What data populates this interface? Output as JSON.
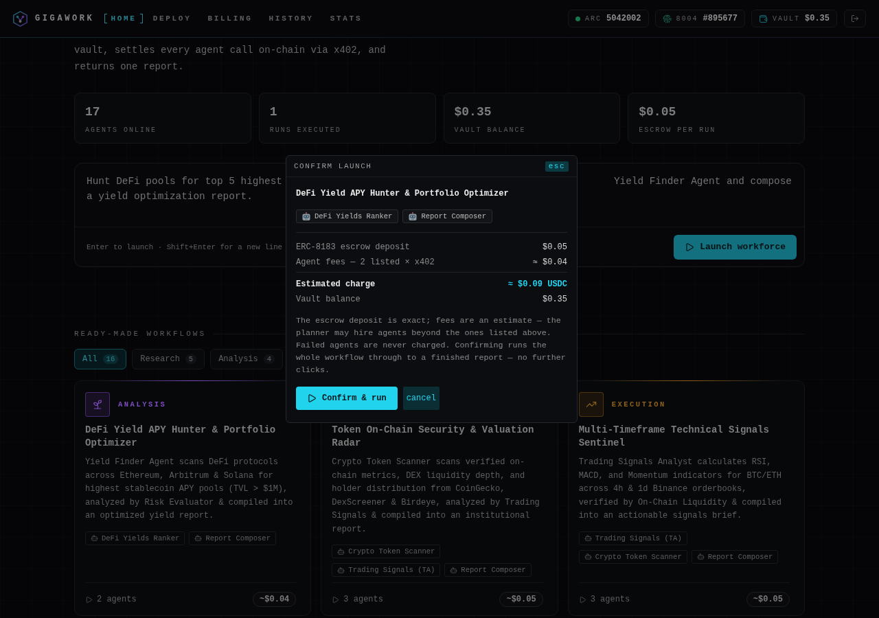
{
  "nav": {
    "brand": "GIGAWORK",
    "links": [
      {
        "label": "HOME",
        "selected": true
      },
      {
        "label": "DEPLOY",
        "selected": false
      },
      {
        "label": "BILLING",
        "selected": false
      },
      {
        "label": "HISTORY",
        "selected": false
      },
      {
        "label": "STATS",
        "selected": false
      }
    ],
    "pills": [
      {
        "kind": "status",
        "label": "ARC",
        "value": "5042002"
      },
      {
        "kind": "identity",
        "label": "8004",
        "value": "#895677"
      },
      {
        "kind": "vault",
        "label": "VAULT",
        "value": "$0.35"
      }
    ]
  },
  "hero": {
    "text": "vault, settles every agent call on-chain via x402, and returns one report."
  },
  "stats": [
    {
      "value": "17",
      "label": "AGENTS ONLINE"
    },
    {
      "value": "1",
      "label": "RUNS EXECUTED"
    },
    {
      "value": "$0.35",
      "label": "VAULT BALANCE"
    },
    {
      "value": "$0.05",
      "label": "ESCROW PER RUN"
    }
  ],
  "prompt": {
    "value_parts": [
      "Hunt DeFi pools for top 5 highest",
      "Yield Finder Agent and compose",
      "a yield optimization report."
    ],
    "hint": "Enter to launch · Shift+Enter for a new line",
    "button": "Launch workforce"
  },
  "workflows": {
    "title": "READY-MADE WORKFLOWS",
    "filters": [
      {
        "label": "All",
        "count": "16",
        "selected": true
      },
      {
        "label": "Research",
        "count": "5",
        "selected": false
      },
      {
        "label": "Analysis",
        "count": "4",
        "selected": false
      }
    ],
    "cards": [
      {
        "kind": "analysis",
        "category": "ANALYSIS",
        "color": "#7b4cc0",
        "title": "DeFi Yield APY Hunter & Portfolio Optimizer",
        "description": "Yield Finder Agent scans DeFi protocols across Ethereum, Arbitrum & Solana for highest stablecoin APY pools (TVL > $1M), analyzed by Risk Evaluator & compiled into an optimized yield report.",
        "agents": [
          "DeFi Yields Ranker",
          "Report Composer"
        ],
        "agent_count": "2 agents",
        "price": "~$0.04"
      },
      {
        "title": "Token On-Chain Security & Valuation Radar",
        "description": "Crypto Token Scanner scans verified on-chain metrics, DEX liquidity depth, and holder distribution from CoinGecko, DexScreener & Birdeye, analyzed by Trading Signals & compiled into an institutional report.",
        "agents": [
          "Crypto Token Scanner",
          "Trading Signals (TA)",
          "Report Composer"
        ],
        "agent_count": "3 agents",
        "price": "~$0.05"
      },
      {
        "kind": "execution",
        "category": "EXECUTION",
        "color": "#8f6018",
        "title": "Multi-Timeframe Technical Signals Sentinel",
        "description": "Trading Signals Analyst calculates RSI, MACD, and Momentum indicators for BTC/ETH across 4h & 1d Binance orderbooks, verified by On-Chain Liquidity & compiled into an actionable signals brief.",
        "agents": [
          "Trading Signals (TA)",
          "Crypto Token Scanner",
          "Report Composer"
        ],
        "agent_count": "3 agents",
        "price": "~$0.05"
      }
    ]
  },
  "modal": {
    "title": "CONFIRM LAUNCH",
    "close": "esc",
    "workflow": "DeFi Yield APY Hunter & Portfolio Optimizer",
    "agents": [
      "DeFi Yields Ranker",
      "Report Composer"
    ],
    "lines": [
      {
        "kind": "item",
        "label": "ERC-8183 escrow deposit",
        "value": "$0.05"
      },
      {
        "kind": "item",
        "label": "Agent fees — 2 listed × x402",
        "value": "≈ $0.04"
      },
      {
        "kind": "total",
        "label": "Estimated charge",
        "value": "≈ $0.09 USDC"
      },
      {
        "kind": "item",
        "label": "Vault balance",
        "value": "$0.35"
      }
    ],
    "note": "The escrow deposit is exact; fees are an estimate — the planner may hire agents beyond the ones listed above. Failed agents are never charged. Confirming runs the whole workflow through to a finished report — no further clicks.",
    "buttons": [
      {
        "kind": "primary",
        "label": "Confirm & run"
      },
      {
        "kind": "secondary",
        "label": "cancel"
      }
    ]
  }
}
